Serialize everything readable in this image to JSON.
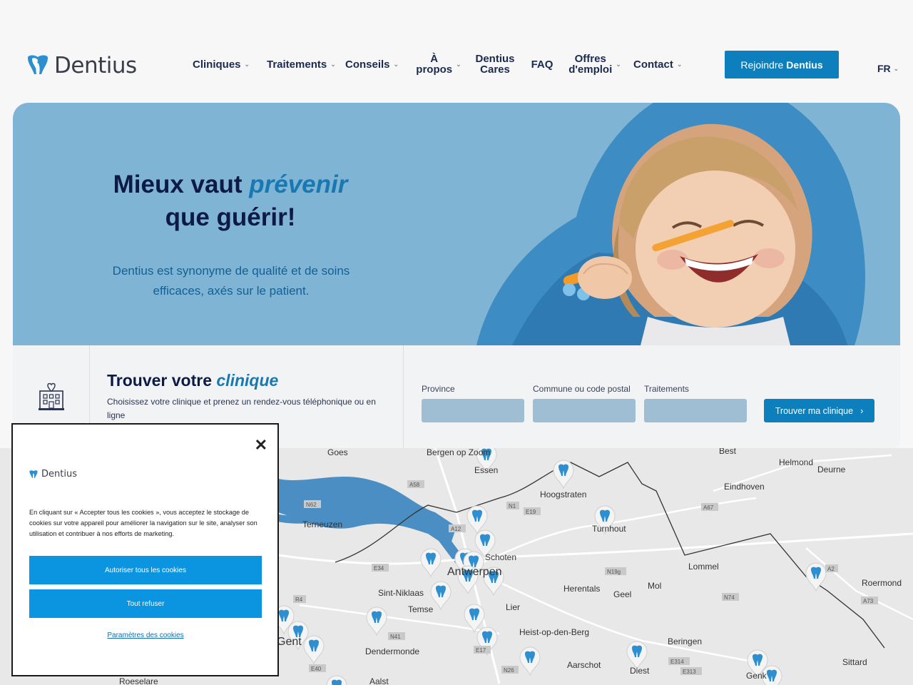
{
  "brand": {
    "name": "Dentius",
    "accent": "#0d7fbd",
    "navy": "#0d1b44"
  },
  "nav": {
    "items": [
      {
        "label": "Cliniques",
        "dropdown": true
      },
      {
        "label": "Traitements",
        "dropdown": true
      },
      {
        "label": "Conseils",
        "dropdown": true
      },
      {
        "label_line1": "À",
        "label_line2": "propos",
        "dropdown": true
      },
      {
        "label_line1": "Dentius",
        "label_line2": "Cares",
        "dropdown": false
      },
      {
        "label": "FAQ",
        "dropdown": false
      },
      {
        "label_line1": "Offres",
        "label_line2": "d'emploi",
        "dropdown": true
      },
      {
        "label": "Contact",
        "dropdown": true
      }
    ],
    "join_prefix": "Rejoindre",
    "join_brand": "Dentius",
    "language": "FR"
  },
  "hero": {
    "title_part1": "Mieux vaut",
    "title_highlight": "prévenir",
    "title_part2": "que guérir!",
    "subtitle": "Dentius est synonyme de qualité et de soins efficaces, axés sur le patient."
  },
  "finder": {
    "title_part1": "Trouver votre",
    "title_highlight": "clinique",
    "description": "Choisissez votre clinique et prenez un rendez-vous téléphonique ou en ligne",
    "fields": [
      {
        "label": "Province",
        "value": ""
      },
      {
        "label": "Commune ou code postal",
        "value": ""
      },
      {
        "label": "Traitements",
        "value": ""
      }
    ],
    "button": "Trouver ma clinique"
  },
  "map": {
    "place_labels": [
      "Goes",
      "Bergen op Zoom",
      "Essen",
      "Best",
      "Helmond",
      "Deurne",
      "Eindhoven",
      "Hoogstraten",
      "Terneuzen",
      "Turnhout",
      "Schoten",
      "Antwerpen",
      "Lommel",
      "Sint-Niklaas",
      "Temse",
      "Herentals",
      "Geel",
      "Mol",
      "Roermond",
      "Lier",
      "Heist-op-den-Berg",
      "Beringen",
      "Dendermonde",
      "Aarschot",
      "Diest",
      "Sittard",
      "Genk",
      "Aalst",
      "Roeselare",
      "Gent"
    ],
    "road_labels": [
      "A58",
      "N62",
      "N1",
      "E19",
      "A12",
      "E34",
      "E313",
      "A67",
      "N19g",
      "N74",
      "E314",
      "A2",
      "A73",
      "R4",
      "N41",
      "E17",
      "N26",
      "E40"
    ]
  },
  "cookie": {
    "logo_text": "Dentius",
    "close_symbol": "✕",
    "text": "En cliquant sur « Accepter tous les cookies », vous acceptez le stockage de cookies sur votre appareil pour améliorer la navigation sur le site, analyser son utilisation et contribuer à nos efforts de marketing.",
    "accept_button": "Autoriser tous les cookies",
    "reject_button": "Tout refuser",
    "settings_link": "Paramètres des cookies"
  }
}
